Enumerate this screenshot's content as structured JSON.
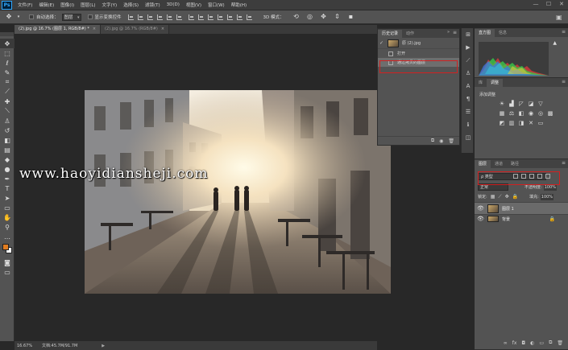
{
  "menubar": {
    "logo": "Ps",
    "items": [
      "文件(F)",
      "编辑(E)",
      "图像(I)",
      "图层(L)",
      "文字(Y)",
      "选择(S)",
      "滤镜(T)",
      "3D(D)",
      "视图(V)",
      "窗口(W)",
      "帮助(H)"
    ],
    "minimize": "—",
    "maximize": "☐",
    "close": "✕"
  },
  "options": {
    "auto_select_label": "自动选择：",
    "auto_select_value": "图层",
    "show_transform_label": "显示变换控件",
    "mode_3d_label": "3D 模式："
  },
  "tabs": [
    {
      "label": "(2).jpg @ 16.7% (图层 1, RGB/8#) *",
      "close": "×"
    },
    {
      "label": "(2).jpg @ 16.7% (RGB/8#)",
      "close": "×"
    }
  ],
  "canvas": {
    "watermark": "www.haoyidiansheji.com"
  },
  "status": {
    "zoom": "16.67%",
    "doc": "文档:45.7M/91.7M",
    "arrow": "▶"
  },
  "history": {
    "tabs": [
      "历史记录",
      "动作"
    ],
    "snapshot_label": "原 (2).jpg",
    "rows": [
      "打开",
      "通过拷贝的图层"
    ],
    "menu_icon": "≡",
    "collapse_icon": "»"
  },
  "histogram": {
    "tabs": [
      "直方图",
      "信息"
    ],
    "warning": "▲",
    "colors": {
      "red": "#e23a3a",
      "green": "#3ad04a",
      "blue": "#3a7ae2",
      "cyan": "#36c8d8",
      "yellow": "#e8d040"
    }
  },
  "adjustments": {
    "tabs": [
      "库",
      "调整"
    ],
    "title": "添加调整"
  },
  "layers": {
    "tabs": [
      "图层",
      "通道",
      "路径"
    ],
    "filter": "ρ 类型",
    "blend_mode": "正常",
    "opacity_label": "不透明度:",
    "opacity_value": "100%",
    "lock_label": "锁定:",
    "fill_label": "填充:",
    "fill_value": "100%",
    "items": [
      {
        "name": "图层 1"
      },
      {
        "name": "背景"
      }
    ]
  }
}
